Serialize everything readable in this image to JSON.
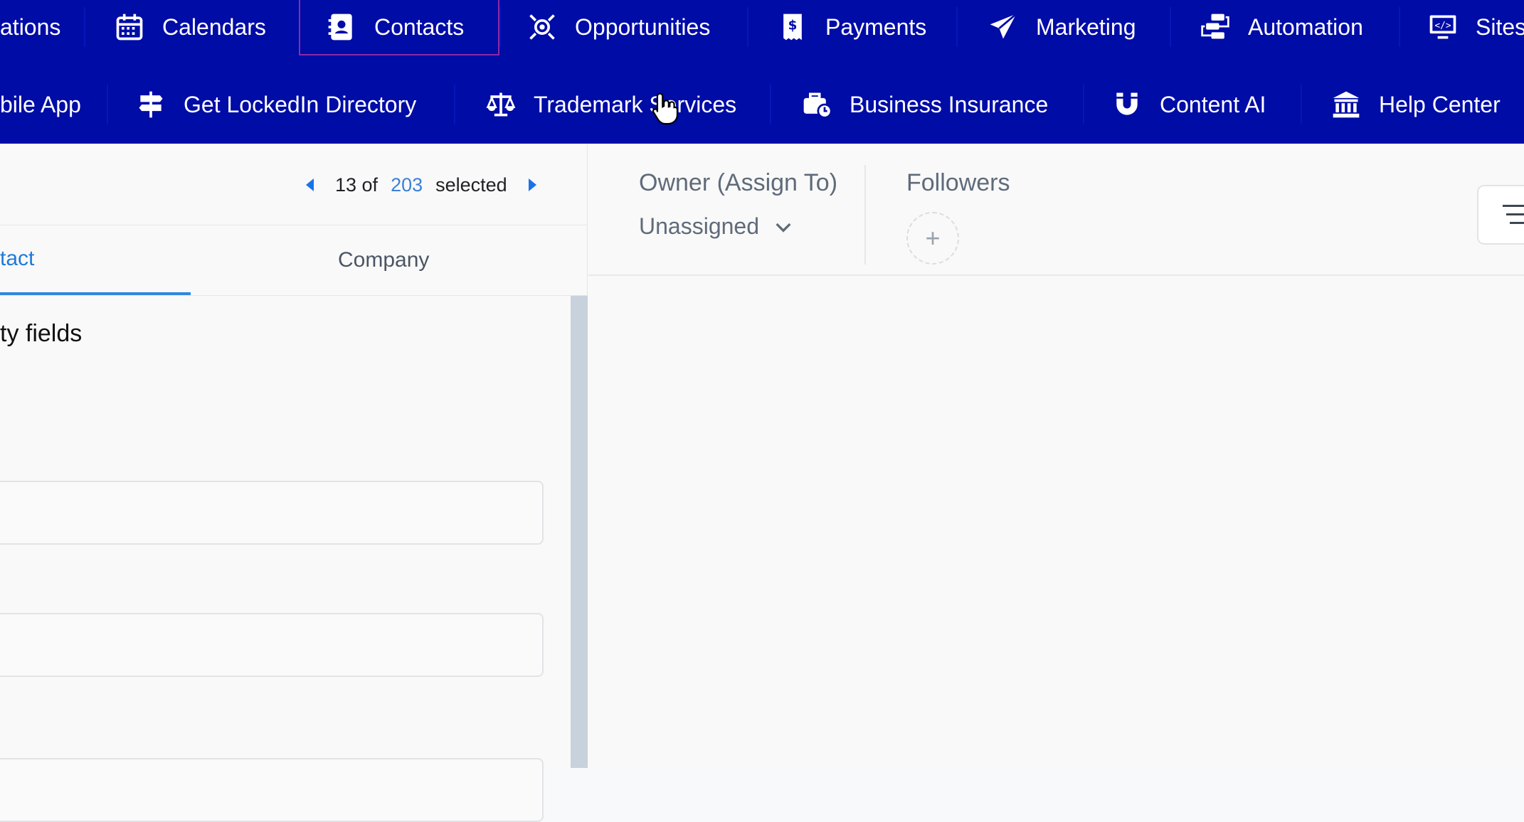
{
  "nav": {
    "row1": [
      {
        "label": "ations",
        "icon": "none"
      },
      {
        "label": "Calendars",
        "icon": "calendar-icon"
      },
      {
        "label": "Contacts",
        "icon": "contact-book-icon",
        "active": true
      },
      {
        "label": "Opportunities",
        "icon": "target-icon"
      },
      {
        "label": "Payments",
        "icon": "receipt-icon"
      },
      {
        "label": "Marketing",
        "icon": "paper-plane-icon"
      },
      {
        "label": "Automation",
        "icon": "workflow-icon"
      },
      {
        "label": "Sites",
        "icon": "code-monitor-icon"
      }
    ],
    "row2": [
      {
        "label": "bile App",
        "icon": "none"
      },
      {
        "label": "Get LockedIn Directory",
        "icon": "signpost-icon"
      },
      {
        "label": "Trademark Services",
        "icon": "scales-icon"
      },
      {
        "label": "Business Insurance",
        "icon": "briefcase-clock-icon"
      },
      {
        "label": "Content AI",
        "icon": "magnet-icon"
      },
      {
        "label": "Help Center",
        "icon": "bank-icon"
      }
    ],
    "active_border_color": "#8d2aa8",
    "background": "#000ca6"
  },
  "pager": {
    "current": "13 of",
    "total": "203",
    "suffix": "selected"
  },
  "tabs": {
    "contact": "tact",
    "company": "Company"
  },
  "section": {
    "title": "ty fields"
  },
  "owner": {
    "label": "Owner (Assign To)",
    "value": "Unassigned"
  },
  "followers": {
    "label": "Followers",
    "add_symbol": "+"
  },
  "colors": {
    "accent": "#1f7ad9",
    "muted_text": "#5f6b7a"
  }
}
